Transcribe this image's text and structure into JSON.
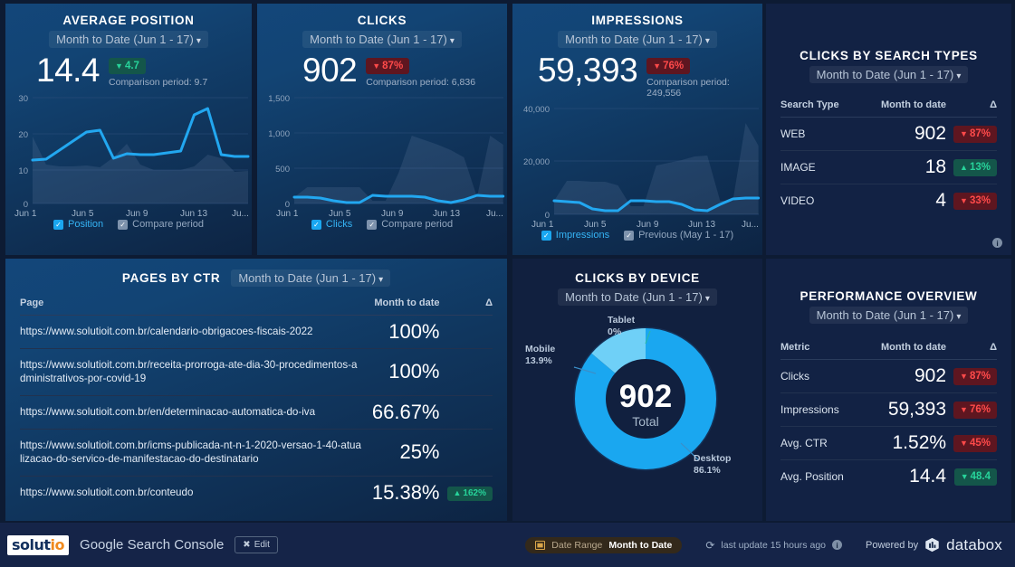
{
  "panels": {
    "average_position": {
      "title": "AVERAGE POSITION",
      "date_range": "Month to Date (Jun 1 - 17)",
      "value": "14.4",
      "delta": "4.7",
      "delta_dir": "down",
      "delta_good": true,
      "comparison": "Comparison period: 9.7",
      "legend": [
        {
          "label": "Position",
          "checked": true,
          "style": "blue"
        },
        {
          "label": "Compare period",
          "checked": true,
          "style": "gray"
        }
      ]
    },
    "clicks": {
      "title": "CLICKS",
      "date_range": "Month to Date (Jun 1 - 17)",
      "value": "902",
      "delta": "87%",
      "delta_dir": "down",
      "delta_good": false,
      "comparison": "Comparison period: 6,836",
      "legend": [
        {
          "label": "Clicks",
          "checked": true,
          "style": "blue"
        },
        {
          "label": "Compare period",
          "checked": true,
          "style": "gray"
        }
      ]
    },
    "impressions": {
      "title": "IMPRESSIONS",
      "date_range": "Month to Date (Jun 1 - 17)",
      "value": "59,393",
      "delta": "76%",
      "delta_dir": "down",
      "delta_good": false,
      "comparison": "Comparison period: 249,556",
      "legend": [
        {
          "label": "Impressions",
          "checked": true,
          "style": "blue"
        },
        {
          "label": "Previous (May 1 - 17)",
          "checked": true,
          "style": "gray"
        }
      ]
    },
    "clicks_by_search_types": {
      "title": "CLICKS BY SEARCH TYPES",
      "date_range": "Month to Date (Jun 1 - 17)",
      "columns": [
        "Search Type",
        "Month to date",
        "Δ"
      ],
      "rows": [
        {
          "name": "WEB",
          "value": "902",
          "delta": "87%",
          "dir": "down",
          "good": false
        },
        {
          "name": "IMAGE",
          "value": "18",
          "delta": "13%",
          "dir": "up",
          "good": true
        },
        {
          "name": "VIDEO",
          "value": "4",
          "delta": "33%",
          "dir": "down",
          "good": false
        }
      ]
    },
    "pages_by_ctr": {
      "title": "PAGES BY CTR",
      "date_range": "Month to Date (Jun 1 - 17)",
      "columns": [
        "Page",
        "Month to date",
        "Δ"
      ],
      "rows": [
        {
          "page": "https://www.solutioit.com.br/calendario-obrigacoes-fiscais-2022",
          "value": "100%",
          "delta": "",
          "dir": "",
          "good": false
        },
        {
          "page": "https://www.solutioit.com.br/receita-prorroga-ate-dia-30-procedimentos-administrativos-por-covid-19",
          "value": "100%",
          "delta": "",
          "dir": "",
          "good": false
        },
        {
          "page": "https://www.solutioit.com.br/en/determinacao-automatica-do-iva",
          "value": "66.67%",
          "delta": "",
          "dir": "",
          "good": false
        },
        {
          "page": "https://www.solutioit.com.br/icms-publicada-nt-n-1-2020-versao-1-40-atualizacao-do-servico-de-manifestacao-do-destinatario",
          "value": "25%",
          "delta": "",
          "dir": "",
          "good": false
        },
        {
          "page": "https://www.solutioit.com.br/conteudo",
          "value": "15.38%",
          "delta": "162%",
          "dir": "up",
          "good": true
        }
      ]
    },
    "clicks_by_device": {
      "title": "CLICKS BY DEVICE",
      "date_range": "Month to Date (Jun 1 - 17)",
      "center_value": "902",
      "center_label": "Total",
      "labels": {
        "tablet_name": "Tablet",
        "tablet_pct": "0%",
        "mobile_name": "Mobile",
        "mobile_pct": "13.9%",
        "desktop_name": "Desktop",
        "desktop_pct": "86.1%"
      }
    },
    "performance_overview": {
      "title": "PERFORMANCE OVERVIEW",
      "date_range": "Month to Date (Jun 1 - 17)",
      "columns": [
        "Metric",
        "Month to date",
        "Δ"
      ],
      "rows": [
        {
          "name": "Clicks",
          "value": "902",
          "delta": "87%",
          "dir": "down",
          "good": false
        },
        {
          "name": "Impressions",
          "value": "59,393",
          "delta": "76%",
          "dir": "down",
          "good": false
        },
        {
          "name": "Avg. CTR",
          "value": "1.52%",
          "delta": "45%",
          "dir": "down",
          "good": false
        },
        {
          "name": "Avg. Position",
          "value": "14.4",
          "delta": "48.4",
          "dir": "down",
          "good": true
        }
      ]
    }
  },
  "footer": {
    "brand_left": "solut",
    "brand_right": "io",
    "dashboard_name": "Google Search Console",
    "edit_label": "Edit",
    "date_range_label": "Date Range",
    "date_range_value": "Month to Date",
    "last_update": "last update 15 hours ago",
    "powered_by": "Powered by",
    "provider": "databox"
  },
  "chart_data": [
    {
      "type": "line",
      "title": "AVERAGE POSITION",
      "ylabel": "",
      "xlabel": "",
      "ylim": [
        0,
        30
      ],
      "yticks": [
        0,
        10,
        20,
        30
      ],
      "ytick_labels": [
        "0",
        "10",
        "20",
        "30"
      ],
      "xtick_labels": [
        "Jun 1",
        "Jun 5",
        "Jun 9",
        "Jun 13",
        "Ju..."
      ],
      "grid": true,
      "legend_position": "bottom",
      "series": [
        {
          "name": "Position",
          "color": "#22a7f0",
          "values": [
            12.8,
            13.0,
            15.5,
            18.0,
            20.5,
            21.2,
            12.7,
            13.8,
            13.6,
            13.5,
            14.0,
            14.7,
            24.5,
            26.2,
            13.6,
            13.0,
            13.0
          ]
        },
        {
          "name": "Compare period",
          "color": "#6d87aa",
          "values": [
            18.6,
            11.0,
            10.5,
            10.5,
            10.6,
            10.2,
            13.0,
            17.0,
            11.0,
            9.7,
            9.6,
            9.6,
            10.8,
            14.0,
            13.0,
            9.0,
            9.3
          ]
        }
      ]
    },
    {
      "type": "line",
      "title": "CLICKS",
      "ylim": [
        0,
        1500
      ],
      "yticks": [
        0,
        500,
        1000,
        1500
      ],
      "ytick_labels": [
        "0",
        "500",
        "1,000",
        "1,500"
      ],
      "xtick_labels": [
        "Jun 1",
        "Jun 5",
        "Jun 9",
        "Jun 13",
        "Ju..."
      ],
      "grid": true,
      "legend_position": "bottom",
      "series": [
        {
          "name": "Clicks",
          "color": "#22a7f0",
          "values": [
            90,
            85,
            75,
            40,
            10,
            10,
            120,
            105,
            100,
            100,
            85,
            40,
            10,
            55,
            110,
            105,
            105
          ]
        },
        {
          "name": "Compare period",
          "color": "#6d87aa",
          "values": [
            95,
            230,
            230,
            230,
            230,
            225,
            40,
            40,
            440,
            960,
            900,
            840,
            760,
            660,
            90,
            960,
            830
          ]
        }
      ]
    },
    {
      "type": "line",
      "title": "IMPRESSIONS",
      "ylim": [
        0,
        40000
      ],
      "yticks": [
        0,
        20000,
        40000
      ],
      "ytick_labels": [
        "0",
        "20,000",
        "40,000"
      ],
      "xtick_labels": [
        "Jun 1",
        "Jun 5",
        "Jun 9",
        "Jun 13",
        "Ju..."
      ],
      "grid": true,
      "legend_position": "bottom",
      "series": [
        {
          "name": "Impressions",
          "color": "#22a7f0",
          "values": [
            5200,
            4800,
            4300,
            2000,
            1500,
            1500,
            5100,
            5000,
            4900,
            4700,
            3700,
            1800,
            1400,
            3700,
            5600,
            6000,
            6000
          ]
        },
        {
          "name": "Previous (May 1 - 17)",
          "color": "#6d87aa",
          "values": [
            5000,
            12600,
            12500,
            12400,
            12300,
            11000,
            3000,
            3000,
            18500,
            19500,
            20500,
            22000,
            22100,
            5000,
            5200,
            34500,
            26000
          ]
        }
      ]
    },
    {
      "type": "pie",
      "title": "CLICKS BY DEVICE",
      "total": 902,
      "labels": [
        "Desktop",
        "Mobile",
        "Tablet"
      ],
      "values": [
        86.1,
        13.9,
        0
      ],
      "colors": [
        "#1aa7f0",
        "#6fd0f7",
        "#2bb8a8"
      ]
    }
  ]
}
